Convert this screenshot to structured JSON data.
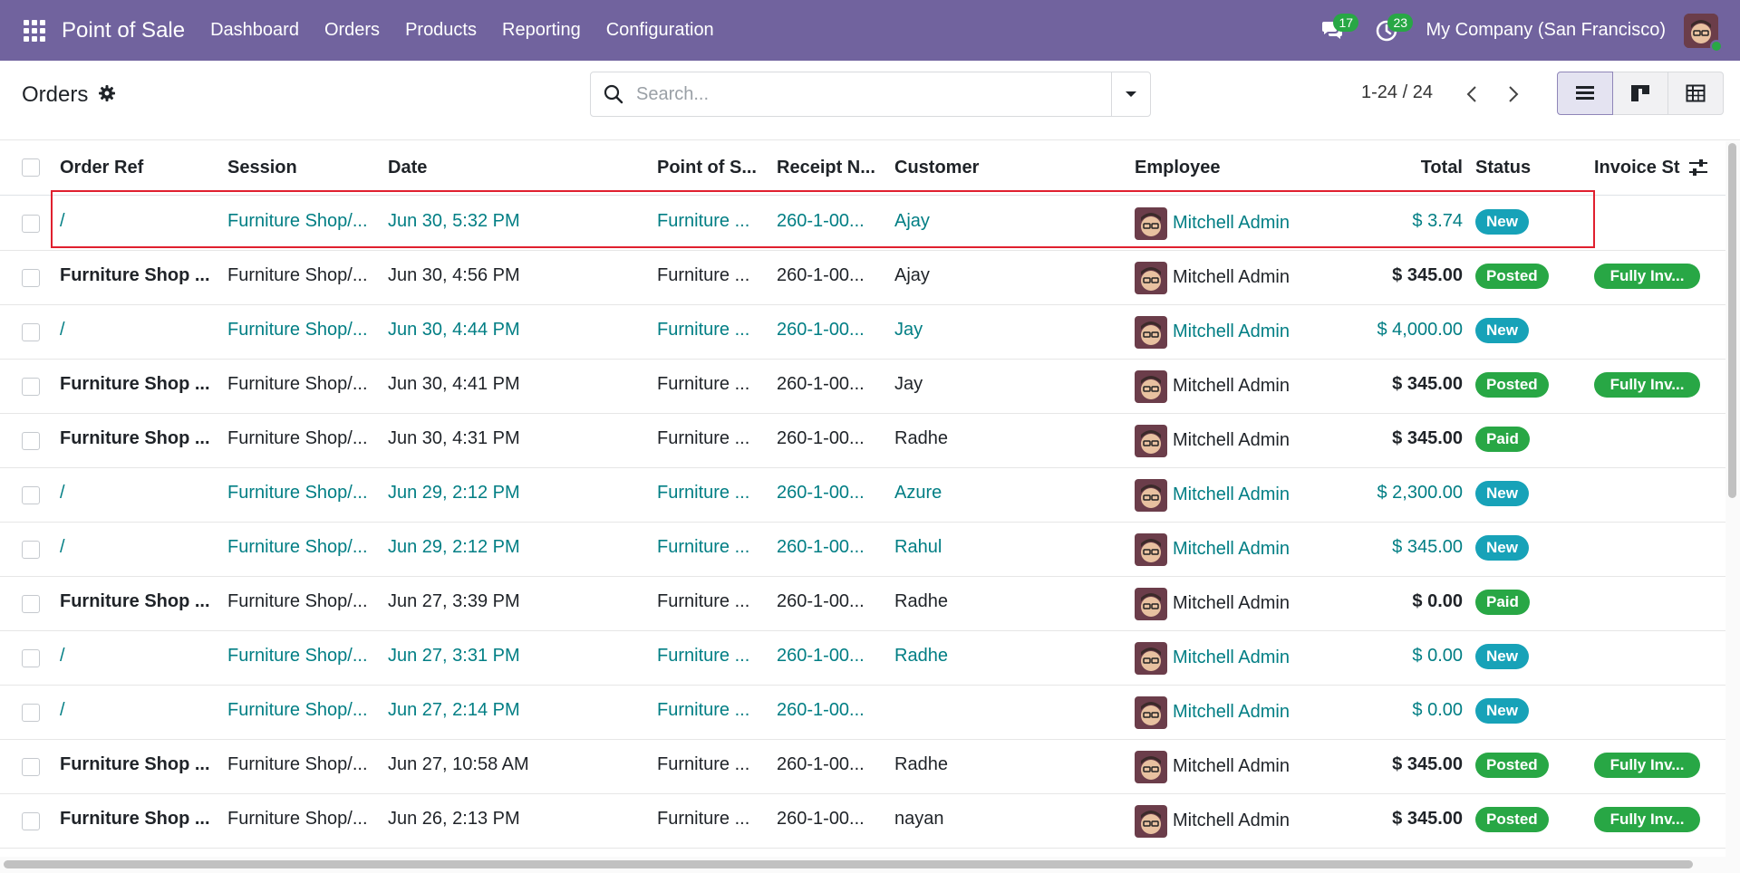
{
  "navbar": {
    "app_name": "Point of Sale",
    "menu": [
      "Dashboard",
      "Orders",
      "Products",
      "Reporting",
      "Configuration"
    ],
    "messages_count": "17",
    "activities_count": "23",
    "company": "My Company (San Francisco)"
  },
  "control": {
    "title": "Orders",
    "search_placeholder": "Search...",
    "pager": "1-24 / 24"
  },
  "table": {
    "columns": [
      "Order Ref",
      "Session",
      "Date",
      "Point of S...",
      "Receipt N...",
      "Customer",
      "Employee",
      "Total",
      "Status",
      "Invoice St"
    ],
    "rows": [
      {
        "ref": "/",
        "session": "Furniture Shop/...",
        "date": "Jun 30, 5:32 PM",
        "pos": "Furniture ...",
        "receipt": "260-1-00...",
        "customer": "Ajay",
        "employee": "Mitchell Admin",
        "total": "$ 3.74",
        "status": "New",
        "invoice": ""
      },
      {
        "ref": "Furniture Shop ...",
        "session": "Furniture Shop/...",
        "date": "Jun 30, 4:56 PM",
        "pos": "Furniture ...",
        "receipt": "260-1-00...",
        "customer": "Ajay",
        "employee": "Mitchell Admin",
        "total": "$ 345.00",
        "status": "Posted",
        "invoice": "Fully Inv..."
      },
      {
        "ref": "/",
        "session": "Furniture Shop/...",
        "date": "Jun 30, 4:44 PM",
        "pos": "Furniture ...",
        "receipt": "260-1-00...",
        "customer": "Jay",
        "employee": "Mitchell Admin",
        "total": "$ 4,000.00",
        "status": "New",
        "invoice": ""
      },
      {
        "ref": "Furniture Shop ...",
        "session": "Furniture Shop/...",
        "date": "Jun 30, 4:41 PM",
        "pos": "Furniture ...",
        "receipt": "260-1-00...",
        "customer": "Jay",
        "employee": "Mitchell Admin",
        "total": "$ 345.00",
        "status": "Posted",
        "invoice": "Fully Inv..."
      },
      {
        "ref": "Furniture Shop ...",
        "session": "Furniture Shop/...",
        "date": "Jun 30, 4:31 PM",
        "pos": "Furniture ...",
        "receipt": "260-1-00...",
        "customer": "Radhe",
        "employee": "Mitchell Admin",
        "total": "$ 345.00",
        "status": "Paid",
        "invoice": ""
      },
      {
        "ref": "/",
        "session": "Furniture Shop/...",
        "date": "Jun 29, 2:12 PM",
        "pos": "Furniture ...",
        "receipt": "260-1-00...",
        "customer": "Azure",
        "employee": "Mitchell Admin",
        "total": "$ 2,300.00",
        "status": "New",
        "invoice": ""
      },
      {
        "ref": "/",
        "session": "Furniture Shop/...",
        "date": "Jun 29, 2:12 PM",
        "pos": "Furniture ...",
        "receipt": "260-1-00...",
        "customer": "Rahul",
        "employee": "Mitchell Admin",
        "total": "$ 345.00",
        "status": "New",
        "invoice": ""
      },
      {
        "ref": "Furniture Shop ...",
        "session": "Furniture Shop/...",
        "date": "Jun 27, 3:39 PM",
        "pos": "Furniture ...",
        "receipt": "260-1-00...",
        "customer": "Radhe",
        "employee": "Mitchell Admin",
        "total": "$ 0.00",
        "status": "Paid",
        "invoice": ""
      },
      {
        "ref": "/",
        "session": "Furniture Shop/...",
        "date": "Jun 27, 3:31 PM",
        "pos": "Furniture ...",
        "receipt": "260-1-00...",
        "customer": "Radhe",
        "employee": "Mitchell Admin",
        "total": "$ 0.00",
        "status": "New",
        "invoice": ""
      },
      {
        "ref": "/",
        "session": "Furniture Shop/...",
        "date": "Jun 27, 2:14 PM",
        "pos": "Furniture ...",
        "receipt": "260-1-00...",
        "customer": "",
        "employee": "Mitchell Admin",
        "total": "$ 0.00",
        "status": "New",
        "invoice": ""
      },
      {
        "ref": "Furniture Shop ...",
        "session": "Furniture Shop/...",
        "date": "Jun 27, 10:58 AM",
        "pos": "Furniture ...",
        "receipt": "260-1-00...",
        "customer": "Radhe",
        "employee": "Mitchell Admin",
        "total": "$ 345.00",
        "status": "Posted",
        "invoice": "Fully Inv..."
      },
      {
        "ref": "Furniture Shop ...",
        "session": "Furniture Shop/...",
        "date": "Jun 26, 2:13 PM",
        "pos": "Furniture ...",
        "receipt": "260-1-00...",
        "customer": "nayan",
        "employee": "Mitchell Admin",
        "total": "$ 345.00",
        "status": "Posted",
        "invoice": "Fully Inv..."
      }
    ]
  },
  "colors": {
    "navbar": "#71639e",
    "link": "#017e84",
    "new_badge": "#17a2b8",
    "green_badge": "#28a745",
    "highlight": "#e0202f"
  }
}
